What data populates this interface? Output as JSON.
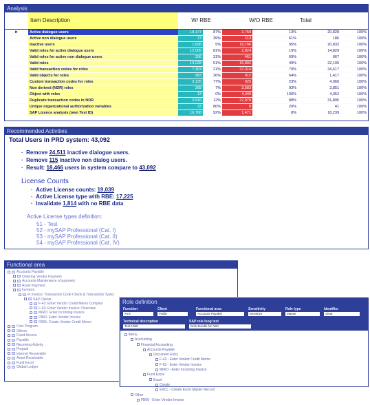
{
  "analysis": {
    "title": "Analysis",
    "headers": {
      "description": "Item Description",
      "with_rbe": "W/ RBE",
      "without_rbe": "W/O RBE",
      "total": "Total"
    },
    "rows": [
      {
        "desc": "Active dialogue users",
        "wr": "18,177",
        "wrp": "87%",
        "wor": "2,769",
        "worp": "13%",
        "tot": "20,828",
        "totp": "100%"
      },
      {
        "desc": "Active non dialogue users",
        "wr": "73",
        "wrp": "39%",
        "wor": "113",
        "worp": "61%",
        "tot": "186",
        "totp": "100%"
      },
      {
        "desc": "Inactive users",
        "wr": "1,836",
        "wrp": "5%",
        "wor": "19,796",
        "worp": "95%",
        "tot": "20,832",
        "totp": "100%"
      },
      {
        "desc": "Valid roles for active dialogue users",
        "wr": "12,005",
        "wrp": "81%",
        "wor": "2,824",
        "worp": "19%",
        "tot": "14,829",
        "totp": "100%"
      },
      {
        "desc": "Valid roles for active non dialogue users",
        "wr": "206",
        "wrp": "31%",
        "wor": "461",
        "worp": "69%",
        "tot": "667",
        "totp": "100%"
      },
      {
        "desc": "Valid roles",
        "wr": "13,028",
        "wrp": "51%",
        "wor": "16,892",
        "worp": "49%",
        "tot": "22,100",
        "totp": "100%"
      },
      {
        "desc": "Valid transaction codes for roles",
        "wr": "7,303",
        "wrp": "21%",
        "wor": "27,314",
        "worp": "79%",
        "tot": "34,617",
        "totp": "100%"
      },
      {
        "desc": "Valid objects for roles",
        "wr": "983",
        "wrp": "36%",
        "wor": "912",
        "worp": "64%",
        "tot": "1,417",
        "totp": "100%"
      },
      {
        "desc": "Custom transaction codes for roles",
        "wr": "3,135",
        "wrp": "77%",
        "wor": "925",
        "worp": "23%",
        "tot": "4,060",
        "totp": "100%"
      },
      {
        "desc": "Non derived (NDR) roles",
        "wr": "268",
        "wrp": "7%",
        "wor": "3,583",
        "worp": "93%",
        "tot": "3,851",
        "totp": "100%"
      },
      {
        "desc": "Object with roles",
        "wr": "13",
        "wrp": "0%",
        "wor": "4,349",
        "worp": "100%",
        "tot": "4,352",
        "totp": "100%"
      },
      {
        "desc": "Duplicate transaction codes in NDR",
        "wr": "3,916",
        "wrp": "12%",
        "wor": "27,979",
        "worp": "88%",
        "tot": "31,895",
        "totp": "100%"
      },
      {
        "desc": "Unique organizational authorization variables",
        "wr": "33",
        "wrp": "80%",
        "wor": "8",
        "worp": "20%",
        "tot": "41",
        "totp": "100%"
      },
      {
        "desc": "SAP Licence analysis (own Test ID)",
        "wr": "16,768",
        "wrp": "92%",
        "wor": "1,471",
        "worp": "8%",
        "tot": "18,239",
        "totp": "100%"
      }
    ]
  },
  "recommended": {
    "title": "Recommended Activities",
    "headline": "Total Users in PRD system: 43,092",
    "bullets": [
      {
        "pre": "Remove",
        "num": "24,511",
        "post": "inactive dialogue users."
      },
      {
        "pre": "Remove",
        "num": "115",
        "post": "inactive non dialog users."
      },
      {
        "pre": "Result:",
        "num": "18,466",
        "post": "users in system compare to",
        "num2": "43,092"
      }
    ],
    "license_title": "License Counts",
    "license_lines": [
      {
        "text": "Active License counts:",
        "num": "19,039"
      },
      {
        "text": "Active License type with RBE:",
        "num": "17,225"
      },
      {
        "text": "Invalidate",
        "num": "1,814",
        "post": "with no RBE data"
      }
    ],
    "def_title": "Active License types definition:",
    "defs": [
      "51 - Test",
      "52 - mySAP Professional (Cat. I)",
      "53 - mySAP Professional (Cat. II)",
      "54 - mySAP Professional (Cat. IV)"
    ]
  },
  "functional": {
    "title": "Functional area",
    "nodes": [
      {
        "label": "Accounts Payable",
        "level": 0
      },
      {
        "label": "Ordering Vendor Payment",
        "level": 1
      },
      {
        "label": "Accounts Maintenance of payment",
        "level": 1
      },
      {
        "label": "Asset Payment",
        "level": 1
      },
      {
        "label": "Invoices",
        "level": 1
      },
      {
        "label": "FI Invoice: Transaction Code Check & Transaction Types",
        "level": 2
      },
      {
        "label": "SAP Clients",
        "level": 3
      },
      {
        "label": "F-43: Enter Vendor Credit Memo Complex",
        "level": 4
      },
      {
        "label": "F-63: Enter Vendor Invoice: Overview",
        "level": 4
      },
      {
        "label": "MIRO: Enter Incoming Invoice",
        "level": 4
      },
      {
        "label": "FB60: Enter Vendor Invoice",
        "level": 4
      },
      {
        "label": "FB65: Create Vendor Credit Memo",
        "level": 4
      },
      {
        "label": "Cost Program",
        "level": 0
      },
      {
        "label": "Others",
        "level": 0
      },
      {
        "label": "Fixed Access",
        "level": 0
      },
      {
        "label": "Payable",
        "level": 0
      },
      {
        "label": "Receiving Activity",
        "level": 0
      },
      {
        "label": "Prepaid",
        "level": 0
      },
      {
        "label": "Internet Receivable",
        "level": 0
      },
      {
        "label": "Asset Receivable",
        "level": 0
      },
      {
        "label": "Fund Excel",
        "level": 0
      },
      {
        "label": "Global Ledger",
        "level": 0
      }
    ]
  },
  "role": {
    "title": "Role definition",
    "fields": [
      {
        "label": "Function",
        "value": "XYZ"
      },
      {
        "label": "Client",
        "value": "Public"
      },
      {
        "label": "Functional area",
        "value": "Accounts Payable"
      },
      {
        "label": "Sensitivity",
        "value": "Sensitive"
      },
      {
        "label": "Role type",
        "value": "Master"
      },
      {
        "label": "Identifier",
        "value": "Clear"
      }
    ],
    "tech_label": "Technical description",
    "tech_value": "Test 1009",
    "role_label": "SAP role long text",
    "role_value": "Role Bundle for ABC",
    "tree": [
      {
        "label": "Menu",
        "level": 0
      },
      {
        "label": "Accounting",
        "level": 1
      },
      {
        "label": "Financial Accounting",
        "level": 2
      },
      {
        "label": "Accounts Payable",
        "level": 3
      },
      {
        "label": "Document Entry",
        "level": 4
      },
      {
        "label": "F-43 - Enter Vendor Credit Memo",
        "level": 5
      },
      {
        "label": "F-63 - Enter Vendor Invoice",
        "level": 5
      },
      {
        "label": "MIRO - Enter Incoming Invoice",
        "level": 5
      },
      {
        "label": "Fund Excel",
        "level": 3
      },
      {
        "label": "Excel",
        "level": 4
      },
      {
        "label": "Create",
        "level": 5
      },
      {
        "label": "EXCL - Create Excel Master Record",
        "level": 5
      },
      {
        "label": "Other",
        "level": 1
      },
      {
        "label": "FB60 - Enter Vendor Invoice",
        "level": 2
      }
    ]
  }
}
